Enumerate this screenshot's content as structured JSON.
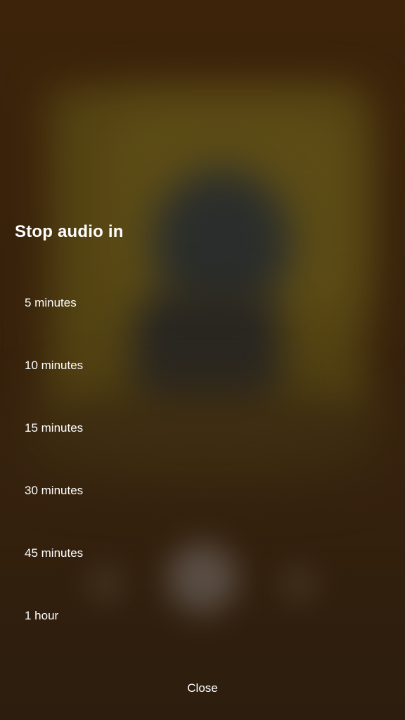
{
  "sheet": {
    "title": "Stop audio in",
    "options": [
      {
        "label": "5 minutes"
      },
      {
        "label": "10 minutes"
      },
      {
        "label": "15 minutes"
      },
      {
        "label": "30 minutes"
      },
      {
        "label": "45 minutes"
      },
      {
        "label": "1 hour"
      }
    ],
    "close_label": "Close"
  },
  "colors": {
    "background": "#41280f",
    "text": "#ffffff"
  }
}
